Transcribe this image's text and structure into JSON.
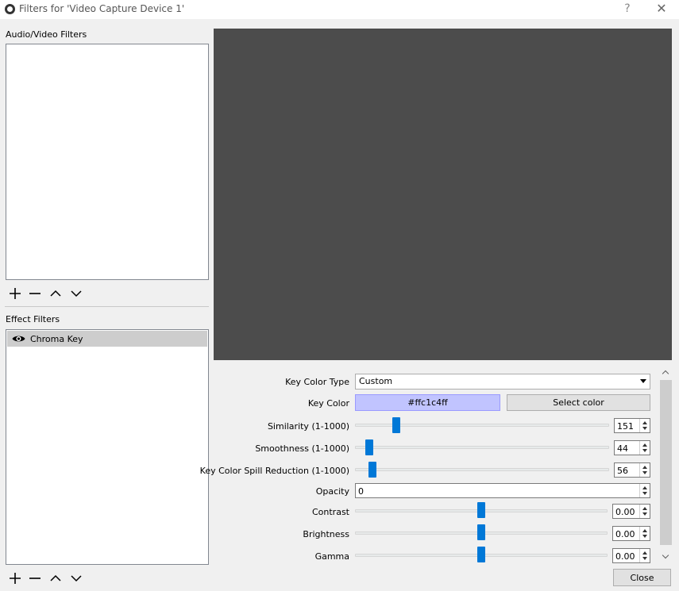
{
  "window": {
    "title": "Filters for 'Video Capture Device 1'",
    "help": "?",
    "close": "✕"
  },
  "audio_video": {
    "label": "Audio/Video Filters",
    "items": []
  },
  "effect": {
    "label": "Effect Filters",
    "items": [
      {
        "label": "Chroma Key",
        "visible": true
      }
    ]
  },
  "properties": {
    "key_color_type": {
      "label": "Key Color Type",
      "value": "Custom"
    },
    "key_color": {
      "label": "Key Color",
      "value": "#ffc1c4ff",
      "swatch": "#c1c4ff",
      "select_label": "Select color"
    },
    "similarity": {
      "label": "Similarity (1-1000)",
      "value": "151",
      "min": 1,
      "max": 1000
    },
    "smoothness": {
      "label": "Smoothness (1-1000)",
      "value": "44",
      "min": 1,
      "max": 1000
    },
    "spill": {
      "label": "Key Color Spill Reduction (1-1000)",
      "value": "56",
      "min": 1,
      "max": 1000
    },
    "opacity": {
      "label": "Opacity",
      "value": "0"
    },
    "contrast": {
      "label": "Contrast",
      "value": "0.00",
      "min": -1,
      "max": 1
    },
    "brightness": {
      "label": "Brightness",
      "value": "0.00",
      "min": -1,
      "max": 1
    },
    "gamma": {
      "label": "Gamma",
      "value": "0.00",
      "min": -1,
      "max": 1
    }
  },
  "footer": {
    "close_label": "Close"
  },
  "colors": {
    "accent": "#0078d7",
    "preview_bg": "#4c4c4c"
  }
}
